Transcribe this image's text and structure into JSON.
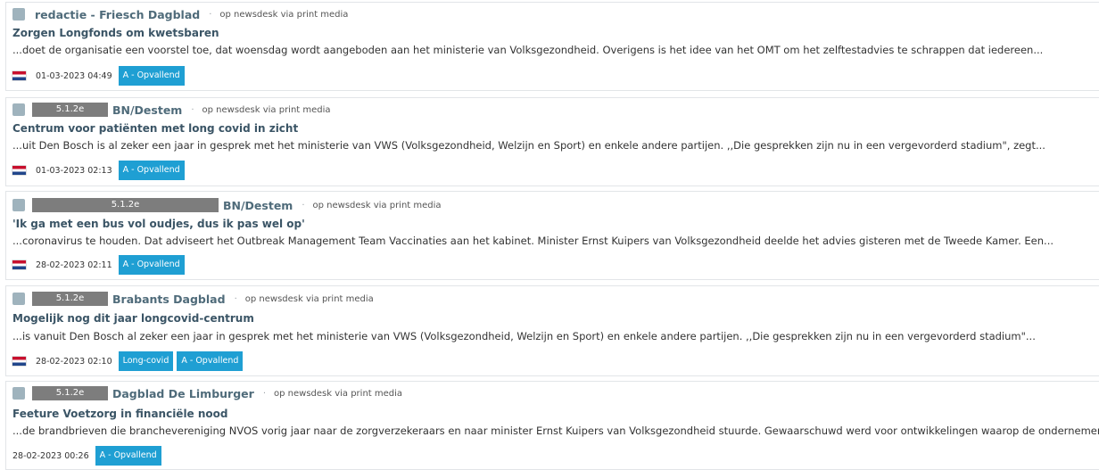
{
  "items": [
    {
      "redaction_label": "",
      "outlet": "redactie - Friesch Dagblad",
      "separator": "·",
      "via": "op newsdesk via print media",
      "title": "Zorgen Longfonds om kwetsbaren",
      "snippet": "...doet de organisatie een voorstel toe, dat woensdag wordt aangeboden aan het ministerie van Volksgezondheid. Overigens is het idee van het OMT om het zelftestadvies te schrappen dat iedereen...",
      "date": "01-03-2023 04:49",
      "tags": [
        "A - Opvallend"
      ],
      "flag": "netherlands-flag"
    },
    {
      "redaction_label": "5.1.2e",
      "outlet": "BN/Destem",
      "separator": "·",
      "via": "op newsdesk via print media",
      "title": "Centrum voor patiënten met long covid in zicht",
      "snippet": "...uit Den Bosch is al zeker een jaar in gesprek met het ministerie van VWS (Volksgezondheid, Welzijn en Sport) en enkele andere partijen. ,,Die gesprekken zijn nu in een vergevorderd stadium\", zegt...",
      "date": "01-03-2023 02:13",
      "tags": [
        "A - Opvallend"
      ],
      "flag": "netherlands-flag"
    },
    {
      "redaction_label": "5.1.2e",
      "outlet": "BN/Destem",
      "separator": "·",
      "via": "op newsdesk via print media",
      "title": "'Ik ga met een bus vol oudjes, dus ik pas wel op'",
      "snippet": "...coronavirus te houden. Dat adviseert het Outbreak Management Team Vaccinaties aan het kabinet. Minister Ernst Kuipers van Volksgezondheid deelde het advies gisteren met de Tweede Kamer. Een...",
      "date": "28-02-2023 02:11",
      "tags": [
        "A - Opvallend"
      ],
      "flag": "netherlands-flag"
    },
    {
      "redaction_label": "5.1.2e",
      "outlet": "Brabants Dagblad",
      "separator": "·",
      "via": "op newsdesk via print media",
      "title": "Mogelijk nog dit jaar longcovid-centrum",
      "snippet": "...is vanuit Den Bosch al zeker een jaar in gesprek met het ministerie van VWS (Volksgezondheid, Welzijn en Sport) en enkele andere partijen. ,,Die gesprekken zijn nu in een vergevorderd stadium\"...",
      "date": "28-02-2023 02:10",
      "tags": [
        "Long-covid",
        "A - Opvallend"
      ],
      "flag": "netherlands-flag"
    },
    {
      "redaction_label": "5.1.2e",
      "outlet": "Dagblad De Limburger",
      "separator": "·",
      "via": "op newsdesk via print media",
      "title": "Feeture Voetzorg in financiële nood",
      "snippet": "...de brandbrieven die branchevereniging NVOS vorig jaar naar de zorgverzekeraars en naar minister Ernst Kuipers van Volksgezondheid stuurde. Gewaarschuwd werd voor ontwikkelingen waarop de ondernemers...",
      "date": "28-02-2023 00:26",
      "tags": [
        "A - Opvallend"
      ],
      "flag": ""
    }
  ],
  "colors": {
    "tag": "#1f9fd3",
    "outlet": "#4f6b7a",
    "title": "#3b5566",
    "redaction": "#7d7d7d"
  }
}
